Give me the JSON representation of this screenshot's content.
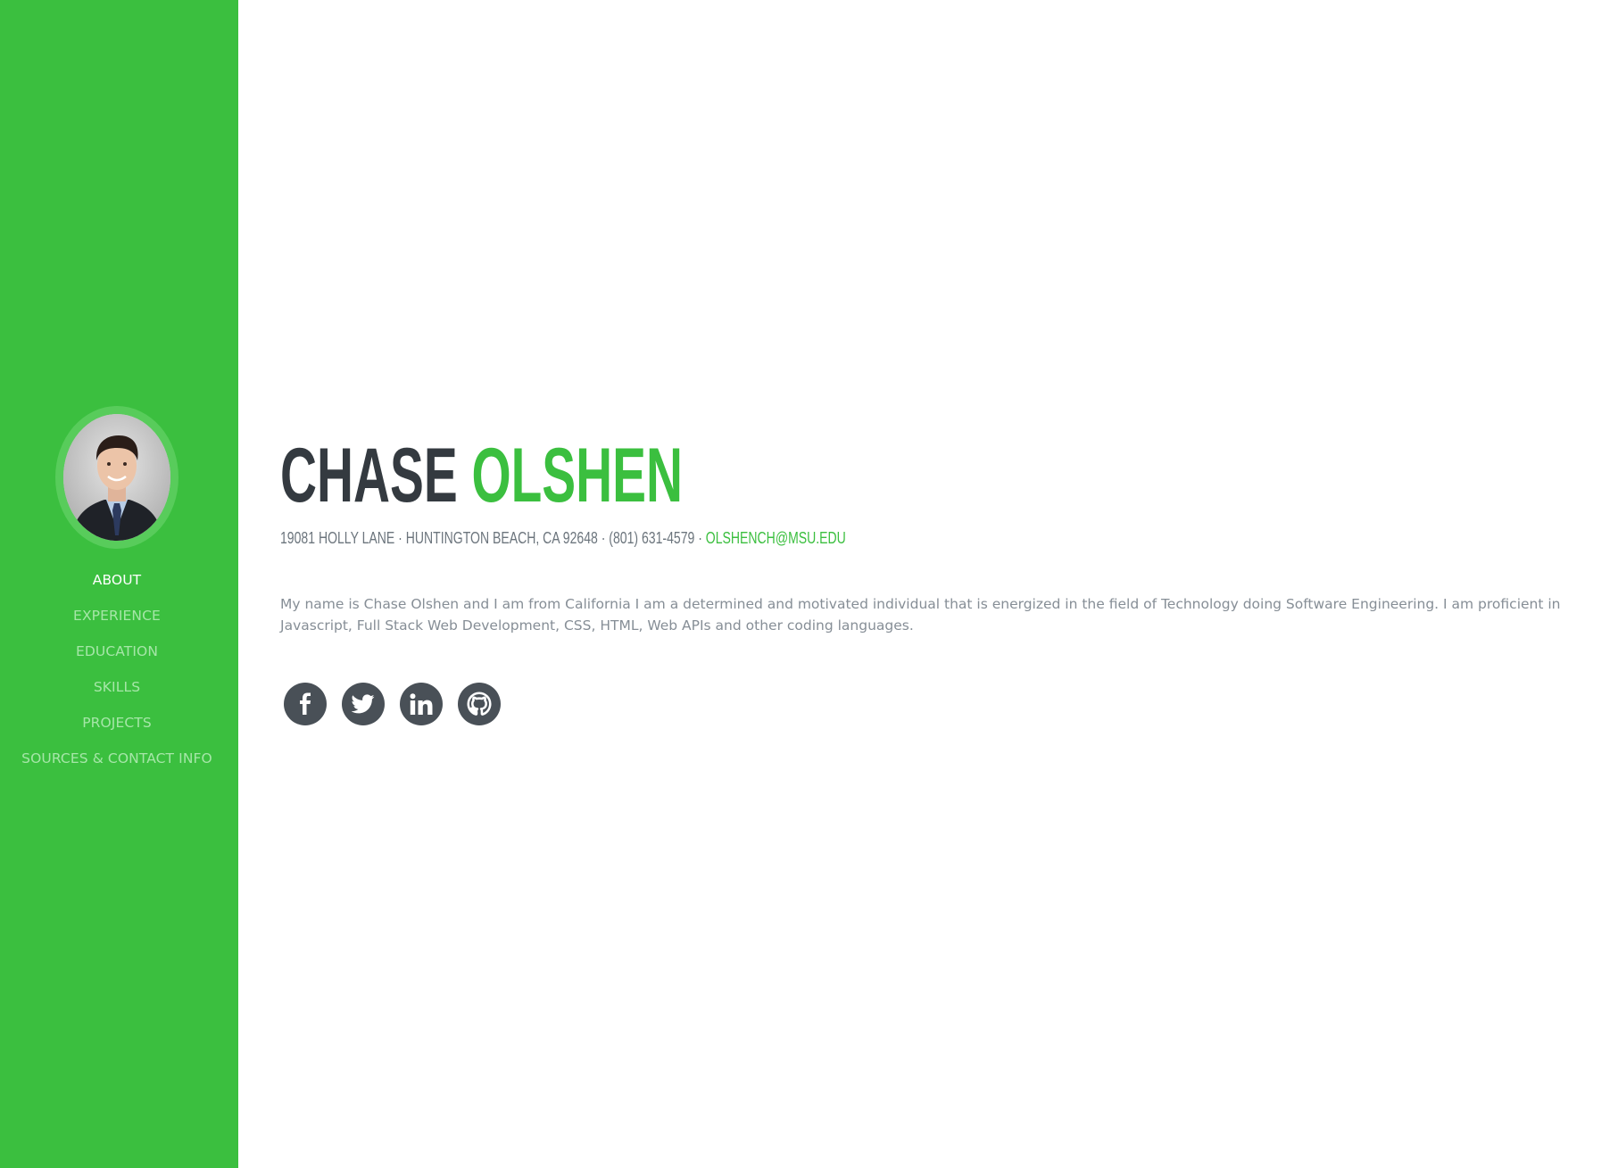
{
  "sidebar": {
    "avatar_alt": "Chase Olshen portrait",
    "nav": [
      {
        "label": "About",
        "active": true
      },
      {
        "label": "Experience",
        "active": false
      },
      {
        "label": "Education",
        "active": false
      },
      {
        "label": "Skills",
        "active": false
      },
      {
        "label": "Projects",
        "active": false
      },
      {
        "label": "Sources & Contact Info",
        "active": false
      }
    ]
  },
  "about": {
    "first_name": "CHASE",
    "last_name": "OLSHEN",
    "address": "19081 Holly Lane · Huntington Beach, CA 92648 · (801) 631-4579 · ",
    "email": "olshench@msu.edu",
    "bio": "My name is Chase Olshen and I am from California I am a determined and motivated individual that is energized in the field of Technology doing Software Engineering. I am proficient in Javascript, Full Stack Web Development, CSS, HTML, Web APIs and other coding languages."
  },
  "social_icons": [
    "facebook-icon",
    "twitter-icon",
    "linkedin-icon",
    "github-icon"
  ],
  "colors": {
    "primary": "#3bbf3f",
    "dark": "#343a40",
    "muted": "#6c757d",
    "icon_bg": "#495057"
  }
}
